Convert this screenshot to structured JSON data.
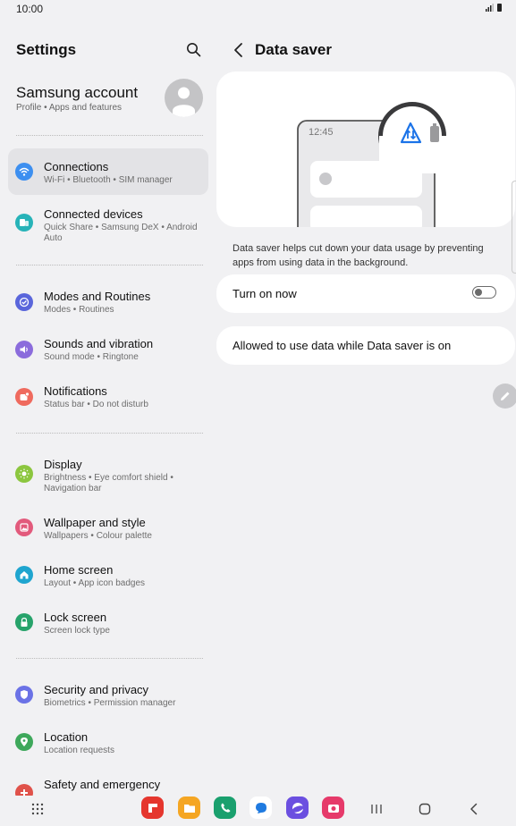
{
  "status": {
    "time": "10:00"
  },
  "left": {
    "title": "Settings",
    "account": {
      "title": "Samsung account",
      "subtitle": "Profile  •  Apps and features"
    },
    "items": [
      {
        "label": "Connections",
        "subtitle": "Wi-Fi  •  Bluetooth  •  SIM manager",
        "color": "#3d8ff0",
        "icon": "wifi-icon",
        "selected": true
      },
      {
        "label": "Connected devices",
        "subtitle": "Quick Share  •  Samsung DeX  •  Android Auto",
        "color": "#27b3b8",
        "icon": "connected-devices-icon"
      },
      {
        "label": "Modes and Routines",
        "subtitle": "Modes  •  Routines",
        "color": "#5a66db",
        "icon": "check-circle-icon"
      },
      {
        "label": "Sounds and vibration",
        "subtitle": "Sound mode  •  Ringtone",
        "color": "#8b6cdc",
        "icon": "volume-icon"
      },
      {
        "label": "Notifications",
        "subtitle": "Status bar  •  Do not disturb",
        "color": "#ef6a5e",
        "icon": "notification-icon"
      },
      {
        "label": "Display",
        "subtitle": "Brightness  •  Eye comfort shield  •  Navigation bar",
        "color": "#8cc63f",
        "icon": "sun-icon"
      },
      {
        "label": "Wallpaper and style",
        "subtitle": "Wallpapers  •  Colour palette",
        "color": "#e25a7c",
        "icon": "wallpaper-icon"
      },
      {
        "label": "Home screen",
        "subtitle": "Layout  •  App icon badges",
        "color": "#1fa5cf",
        "icon": "home-icon"
      },
      {
        "label": "Lock screen",
        "subtitle": "Screen lock type",
        "color": "#27a36b",
        "icon": "lock-icon"
      },
      {
        "label": "Security and privacy",
        "subtitle": "Biometrics  •  Permission manager",
        "color": "#6b72e6",
        "icon": "shield-icon"
      },
      {
        "label": "Location",
        "subtitle": "Location requests",
        "color": "#3ea85b",
        "icon": "location-pin-icon"
      },
      {
        "label": "Safety and emergency",
        "subtitle": "",
        "color": "#e0524a",
        "icon": "emergency-icon"
      }
    ]
  },
  "right": {
    "title": "Data saver",
    "illustration": {
      "clock": "12:45"
    },
    "description": "Data saver helps cut down your data usage by preventing apps from using data in the background.",
    "turn_on": {
      "label": "Turn on now",
      "checked": false
    },
    "allowed": {
      "label": "Allowed to use data while Data saver is on"
    }
  },
  "navbar": {
    "apps": [
      {
        "name": "app-drawer",
        "color": "#444444"
      },
      {
        "name": "flipboard",
        "color": "#e5362e"
      },
      {
        "name": "my-files",
        "color": "#f5a623"
      },
      {
        "name": "phone",
        "color": "#1aa06e"
      },
      {
        "name": "messages",
        "color": "#1f7ae0"
      },
      {
        "name": "internet",
        "color": "#6b4fe0"
      },
      {
        "name": "camera",
        "color": "#e63a6a"
      }
    ]
  }
}
